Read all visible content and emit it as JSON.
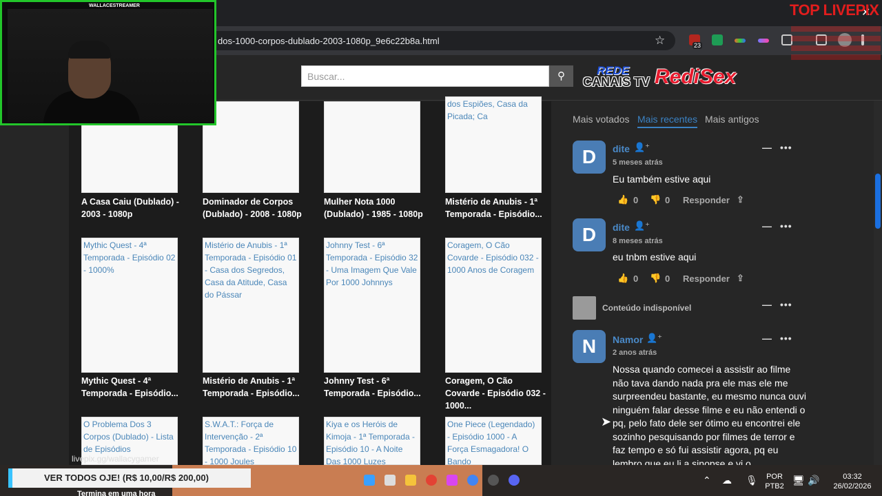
{
  "browser": {
    "url": "dos-1000-corpos-dublado-2003-1080p_9e6c22b8a.html",
    "badge_count": "23"
  },
  "site": {
    "search_placeholder": "Buscar...",
    "logo_text_1": "REDE",
    "logo_text_2": "CANAIS TV",
    "logo_text_3": "RediSex"
  },
  "grid": {
    "row1": [
      {
        "alt": "",
        "title": "A Casa Caiu (Dublado) - 2003 - 1080p"
      },
      {
        "alt": "",
        "title": "Dominador de Corpos (Dublado) - 2008 - 1080p"
      },
      {
        "alt": "",
        "title": "Mulher Nota 1000 (Dublado) - 1985 - 1080p"
      },
      {
        "alt": "dos Espiões, Casa da Picada; Ca",
        "title": "Mistério de Anubis - 1ª Temporada - Episódio..."
      }
    ],
    "row2": [
      {
        "alt": "Mythic Quest - 4ª Temporada - Episódio 02 - 1000%",
        "title": "Mythic Quest - 4ª Temporada - Episódio..."
      },
      {
        "alt": "Mistério de Anubis - 1ª Temporada - Episódio 01 - Casa dos Segredos, Casa da Atitude, Casa do Pássar",
        "title": "Mistério de Anubis - 1ª Temporada - Episódio..."
      },
      {
        "alt": "Johnny Test - 6ª Temporada - Episódio 32 - Uma Imagem Que Vale Por 1000 Johnnys",
        "title": "Johnny Test - 6ª Temporada - Episódio..."
      },
      {
        "alt": "Coragem, O Cão Covarde - Episódio 032 - 1000 Anos de Coragem",
        "title": "Coragem, O Cão Covarde - Episódio 032 - 1000..."
      }
    ],
    "row3": [
      {
        "alt": "O Problema Dos 3 Corpos (Dublado) - Lista de Episódios"
      },
      {
        "alt": "S.W.A.T.: Força de Intervenção - 2ª Temporada - Episódio 10 - 1000 Joules"
      },
      {
        "alt": "Kiya e os Heróis de Kimoja - 1ª Temporada - Episódio 10 - A Noite Das 1000 Luzes"
      },
      {
        "alt": "One Piece (Legendado) - Episódio 1000 - A Força Esmagadora! O Bando"
      }
    ]
  },
  "comments": {
    "tabs": [
      "Mais votados",
      "Mais recentes",
      "Mais antigos"
    ],
    "reply_label": "Responder",
    "list": [
      {
        "initial": "D",
        "name": "dite",
        "time": "5 meses atrás",
        "text": "Eu também estive aqui",
        "likes": "0",
        "dislikes": "0"
      },
      {
        "initial": "D",
        "name": "dite",
        "time": "8 meses atrás",
        "text": "eu tnbm estive aqui",
        "likes": "0",
        "dislikes": "0"
      },
      {
        "unavailable": "Conteúdo indisponível"
      },
      {
        "initial": "N",
        "name": "Namor",
        "time": "2 anos atrás",
        "text": "Nossa quando comecei a assistir ao filme não tava dando nada pra ele mas ele me surpreendeu bastante, eu mesmo nunca ouvi ninguém falar desse filme e eu não entendi o pq, pelo fato dele ser ótimo eu encontrei ele sozinho pesquisando por filmes de terror e faz tempo e só fui assistir agora, pq eu lembro que eu li a sinopse e vi o"
      }
    ]
  },
  "overlay": {
    "streamer_name": "WALLACESTREAMER",
    "livepix_title": "TOP LIVEPIX",
    "watermark": "livepix.gg/wallacygamer",
    "banner_text": "VER TODOS OJE! (R$ 10,00/R$ 200,00)",
    "banner_sub": "Termina em uma hora"
  },
  "taskbar": {
    "lang_1": "POR",
    "lang_2": "PTB2",
    "time": "03:32",
    "date": "26/02/2026"
  },
  "colors": {
    "accent": "#3b82c4",
    "avatar": "#4a7db5",
    "cam_border": "#22c62a",
    "livepix": "#e11d1d"
  }
}
